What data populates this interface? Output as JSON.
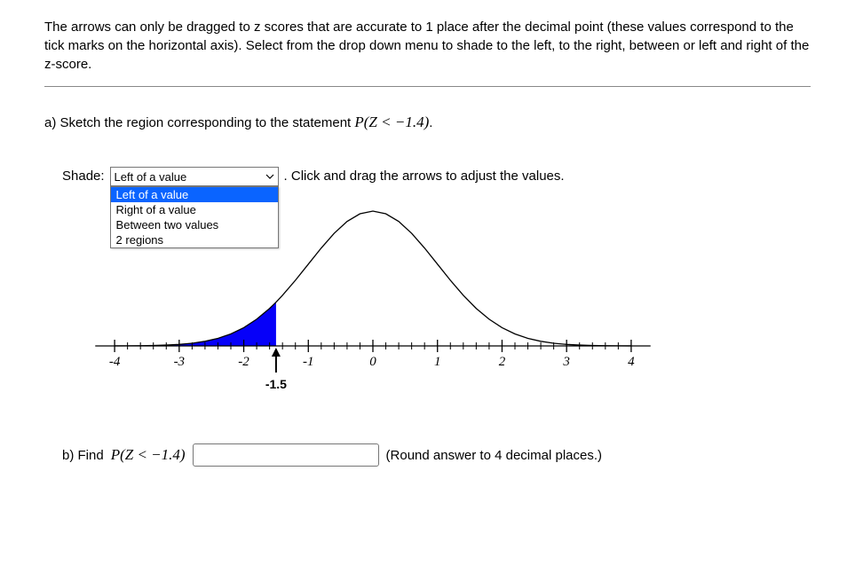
{
  "instructions": "The arrows can only be dragged to z scores that are accurate to 1 place after the decimal point (these values correspond to the tick marks on the horizontal axis). Select from the drop down menu to shade to the left, to the right, between or left and right of the z-score.",
  "question_a": {
    "prefix": "a) Sketch the region corresponding to the statement ",
    "math": "P(Z < −1.4)",
    "suffix": "."
  },
  "shade": {
    "label": "Shade:",
    "selected": "Left of a value",
    "options": [
      "Left of a value",
      "Right of a value",
      "Between two values",
      "2 regions"
    ],
    "after": ". Click and drag the arrows to adjust the values."
  },
  "chart_data": {
    "type": "line",
    "title": "",
    "xlabel": "",
    "ylabel": "",
    "xlim": [
      -4.4,
      4.4
    ],
    "ylim": [
      0,
      0.42
    ],
    "x_ticks": [
      -4,
      -3,
      -2,
      -1,
      0,
      1,
      2,
      3,
      4
    ],
    "x_tick_labels": [
      "-4",
      "-3",
      "-2",
      "-1",
      "0",
      "1",
      "2",
      "3",
      "4"
    ],
    "minor_tick_step": 0.2,
    "arrow_value": -1.5,
    "arrow_label": "-1.5",
    "shade_region": {
      "type": "left",
      "boundary": -1.5
    },
    "series": [
      {
        "name": "normal_pdf",
        "x": [
          -4.0,
          -3.8,
          -3.6,
          -3.4,
          -3.2,
          -3.0,
          -2.8,
          -2.6,
          -2.4,
          -2.2,
          -2.0,
          -1.8,
          -1.6,
          -1.5,
          -1.4,
          -1.2,
          -1.0,
          -0.8,
          -0.6,
          -0.4,
          -0.2,
          0.0,
          0.2,
          0.4,
          0.6,
          0.8,
          1.0,
          1.2,
          1.4,
          1.6,
          1.8,
          2.0,
          2.2,
          2.4,
          2.6,
          2.8,
          3.0,
          3.2,
          3.4,
          3.6,
          3.8,
          4.0
        ],
        "y": [
          0.0001,
          0.0003,
          0.0006,
          0.0012,
          0.0024,
          0.0044,
          0.0079,
          0.0136,
          0.0224,
          0.0355,
          0.054,
          0.079,
          0.1109,
          0.1295,
          0.1497,
          0.1942,
          0.242,
          0.2897,
          0.3332,
          0.3683,
          0.391,
          0.3989,
          0.391,
          0.3683,
          0.3332,
          0.2897,
          0.242,
          0.1942,
          0.1497,
          0.1109,
          0.079,
          0.054,
          0.0355,
          0.0224,
          0.0136,
          0.0079,
          0.0044,
          0.0024,
          0.0012,
          0.0006,
          0.0003,
          0.0001
        ]
      }
    ]
  },
  "question_b": {
    "prefix": "b) Find ",
    "math": "P(Z < −1.4)",
    "value": "",
    "hint": "(Round answer to 4 decimal places.)"
  }
}
